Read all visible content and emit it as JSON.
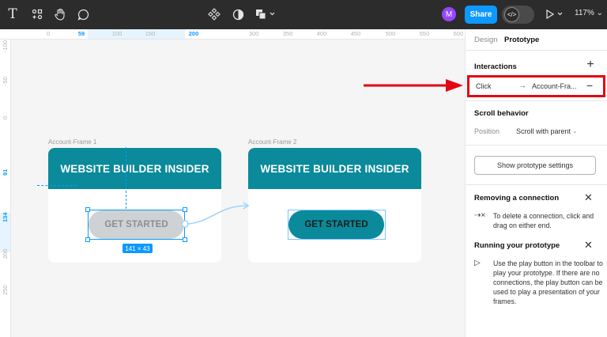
{
  "toolbar": {
    "icons": [
      "text-icon",
      "components-icon",
      "hand-icon",
      "comment-icon",
      "component-icon",
      "contrast-icon",
      "shapes-icon",
      "play-icon"
    ],
    "avatar_initial": "M",
    "share_label": "Share",
    "zoom": "117%"
  },
  "rulers": {
    "top": [
      {
        "v": "0",
        "hl": false
      },
      {
        "v": "59",
        "hl": true
      },
      {
        "v": "100",
        "hl": false
      },
      {
        "v": "150",
        "hl": false
      },
      {
        "v": "200",
        "hl": true
      },
      {
        "v": "300",
        "hl": false
      },
      {
        "v": "350",
        "hl": false
      },
      {
        "v": "400",
        "hl": false
      },
      {
        "v": "450",
        "hl": false
      },
      {
        "v": "500",
        "hl": false
      },
      {
        "v": "550",
        "hl": false
      },
      {
        "v": "600",
        "hl": false
      }
    ],
    "left": [
      {
        "v": "-100",
        "hl": false
      },
      {
        "v": "-50",
        "hl": false
      },
      {
        "v": "0",
        "hl": false
      },
      {
        "v": "91",
        "hl": true
      },
      {
        "v": "134",
        "hl": true
      },
      {
        "v": "200",
        "hl": false
      },
      {
        "v": "250",
        "hl": false
      }
    ]
  },
  "canvas": {
    "frame1": {
      "label": "Account-Frame 1",
      "heading": "WEBSITE BUILDER INSIDER",
      "button": "GET STARTED"
    },
    "frame2": {
      "label": "Account-Frame 2",
      "heading": "WEBSITE BUILDER INSIDER",
      "button": "GET STARTED"
    },
    "selection_size": "141 × 43"
  },
  "panel": {
    "tabs": {
      "design": "Design",
      "prototype": "Prototype"
    },
    "interactions": {
      "title": "Interactions",
      "row": {
        "trigger": "Click",
        "arrow": "→",
        "target": "Account-Fra..."
      }
    },
    "scroll": {
      "title": "Scroll behavior",
      "label": "Position",
      "value": "Scroll with parent"
    },
    "settings_button": "Show prototype settings",
    "removing": {
      "title": "Removing a connection",
      "text": "To delete a connection, click and drag on either end."
    },
    "running": {
      "title": "Running your prototype",
      "text": "Use the play button in the toolbar to play your prototype. If there are no connections, the play button can be used to play a presentation of your frames."
    }
  },
  "colors": {
    "toolbar": "#2c2c2c",
    "accent": "#0d99ff",
    "teal": "#0a8a9b",
    "highlight": "#e30613"
  }
}
